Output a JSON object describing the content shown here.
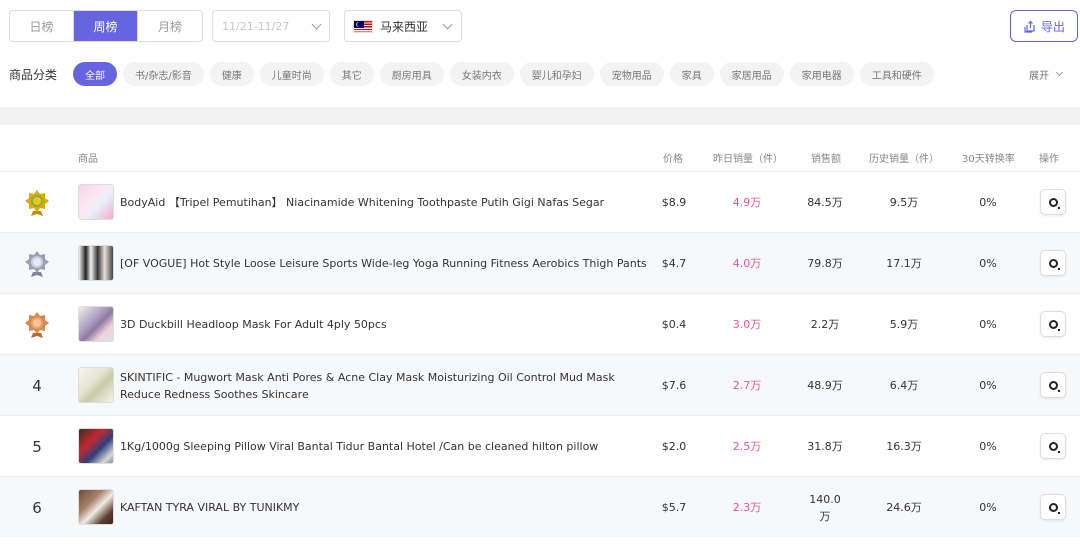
{
  "toolbar": {
    "tabs": [
      {
        "label": "日榜",
        "active": false
      },
      {
        "label": "周榜",
        "active": true
      },
      {
        "label": "月榜",
        "active": false
      }
    ],
    "date_range_placeholder": "11/21-11/27",
    "country": "马来西亚",
    "export_label": "导出"
  },
  "categories": {
    "title": "商品分类",
    "items": [
      "全部",
      "书/杂志/影音",
      "健康",
      "儿童时尚",
      "其它",
      "厨房用具",
      "女装内衣",
      "婴儿和孕妇",
      "宠物用品",
      "家具",
      "家居用品",
      "家用电器",
      "工具和硬件"
    ],
    "active_index": 0,
    "expand_label": "展开"
  },
  "table": {
    "headers": {
      "product": "商品",
      "price": "价格",
      "yesterday_sales": "昨日销量（件）",
      "revenue": "销售额",
      "history_sales": "历史销量（件）",
      "conversion_30d": "30天转换率",
      "actions": "操作"
    },
    "rows": [
      {
        "rank": "",
        "medal": "gold",
        "name": "BodyAid 【Tripel Pemutihan】 Niacinamide Whitening Toothpaste Putih Gigi Nafas Segar",
        "price": "$8.9",
        "yesterday": "4.9万",
        "revenue": "84.5万",
        "history": "9.5万",
        "rate": "0%"
      },
      {
        "rank": "",
        "medal": "silver",
        "name": "[OF VOGUE] Hot Style Loose Leisure Sports Wide-leg Yoga Running Fitness Aerobics Thigh Pants",
        "price": "$4.7",
        "yesterday": "4.0万",
        "revenue": "79.8万",
        "history": "17.1万",
        "rate": "0%"
      },
      {
        "rank": "",
        "medal": "bronze",
        "name": "3D Duckbill Headloop Mask For Adult 4ply 50pcs",
        "price": "$0.4",
        "yesterday": "3.0万",
        "revenue": "2.2万",
        "history": "5.9万",
        "rate": "0%"
      },
      {
        "rank": "4",
        "medal": "",
        "name": "SKINTIFIC - Mugwort Mask Anti Pores & Acne Clay Mask Moisturizing Oil Control Mud Mask Reduce Redness Soothes Skincare",
        "price": "$7.6",
        "yesterday": "2.7万",
        "revenue": "48.9万",
        "history": "6.4万",
        "rate": "0%"
      },
      {
        "rank": "5",
        "medal": "",
        "name": "1Kg/1000g Sleeping Pillow Viral Bantal Tidur Bantal Hotel /Can be cleaned hilton pillow",
        "price": "$2.0",
        "yesterday": "2.5万",
        "revenue": "31.8万",
        "history": "16.3万",
        "rate": "0%"
      },
      {
        "rank": "6",
        "medal": "",
        "name": "KAFTAN TYRA VIRAL BY TUNIKMY",
        "price": "$5.7",
        "yesterday": "2.3万",
        "revenue": "140.0万",
        "history": "24.6万",
        "rate": "0%"
      }
    ]
  },
  "colors": {
    "accent": "#6664e0",
    "sales_pink": "#e5559a",
    "gold": "#e0a800",
    "silver": "#9aa0b8",
    "bronze": "#d9874a"
  }
}
